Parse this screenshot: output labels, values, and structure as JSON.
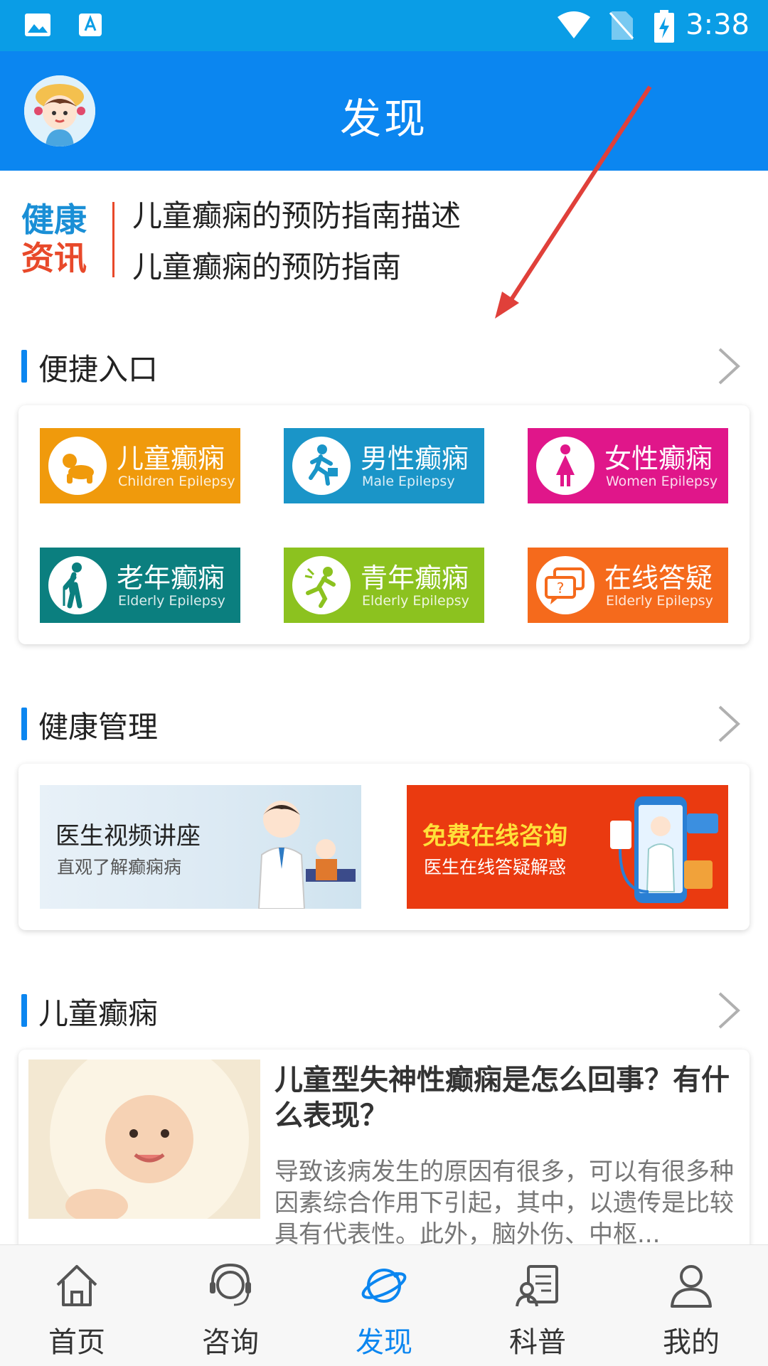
{
  "status_bar": {
    "time": "3:38"
  },
  "app_bar": {
    "title": "发现"
  },
  "news": {
    "logo_line1": "健康",
    "logo_line2": "资讯",
    "items": [
      "儿童癫痫的预防指南描述",
      "儿童癫痫的预防指南"
    ]
  },
  "quick_entry": {
    "title": "便捷入口",
    "tiles": [
      {
        "cn": "儿童癫痫",
        "en": "Children Epilepsy",
        "color": "#f09a0c"
      },
      {
        "cn": "男性癫痫",
        "en": "Male Epilepsy",
        "color": "#1a95c8"
      },
      {
        "cn": "女性癫痫",
        "en": "Women Epilepsy",
        "color": "#e0168a"
      },
      {
        "cn": "老年癫痫",
        "en": "Elderly Epilepsy",
        "color": "#0b7f7f"
      },
      {
        "cn": "青年癫痫",
        "en": "Elderly Epilepsy",
        "color": "#8cc21f"
      },
      {
        "cn": "在线答疑",
        "en": "Elderly Epilepsy",
        "color": "#f56a1c"
      }
    ]
  },
  "health_mgmt": {
    "title": "健康管理",
    "banners": [
      {
        "title": "医生视频讲座",
        "subtitle": "直观了解癫痫病"
      },
      {
        "title": "免费在线咨询",
        "subtitle": "医生在线答疑解惑"
      }
    ]
  },
  "children_section": {
    "title": "儿童癫痫",
    "article": {
      "title": "儿童型失神性癫痫是怎么回事？有什么表现？",
      "desc": "导致该病发生的原因有很多，可以有很多种因素综合作用下引起，其中，以遗传是比较具有代表性。此外，脑外伤、中枢..."
    }
  },
  "bottom_nav": {
    "items": [
      {
        "label": "首页",
        "icon": "home-icon"
      },
      {
        "label": "咨询",
        "icon": "headset-icon"
      },
      {
        "label": "发现",
        "icon": "planet-icon"
      },
      {
        "label": "科普",
        "icon": "science-icon"
      },
      {
        "label": "我的",
        "icon": "profile-icon"
      }
    ],
    "active": "发现"
  }
}
